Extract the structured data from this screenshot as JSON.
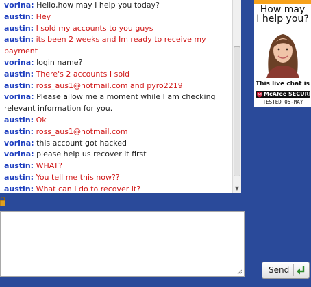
{
  "transcript": {
    "messages": [
      {
        "sender": "vorina:",
        "role": "agent",
        "text": "Hello,how may I help you today?"
      },
      {
        "sender": "austin:",
        "role": "user",
        "text": "Hey"
      },
      {
        "sender": "austin:",
        "role": "user",
        "text": "I sold my accounts to you guys"
      },
      {
        "sender": "austin:",
        "role": "user",
        "text": "its been 2 weeks and Im ready to receive my payment"
      },
      {
        "sender": "vorina:",
        "role": "agent",
        "text": "login name?"
      },
      {
        "sender": "austin:",
        "role": "user",
        "text": "There's 2 accounts I sold"
      },
      {
        "sender": "austin:",
        "role": "user",
        "text": "ross_aus1@hotmail.com and pyro2219"
      },
      {
        "sender": "vorina:",
        "role": "agent",
        "text": "Please allow me a moment while I am checking relevant information for you."
      },
      {
        "sender": "austin:",
        "role": "user",
        "text": "Ok"
      },
      {
        "sender": "austin:",
        "role": "user",
        "text": "ross_aus1@hotmail.com"
      },
      {
        "sender": "vorina:",
        "role": "agent",
        "text": "this account got hacked"
      },
      {
        "sender": "vorina:",
        "role": "agent",
        "text": "please help us recover it first"
      },
      {
        "sender": "austin:",
        "role": "user",
        "text": "WHAT?"
      },
      {
        "sender": "austin:",
        "role": "user",
        "text": "You tell me this now??"
      },
      {
        "sender": "austin:",
        "role": "user",
        "text": "What can I do to recover it?"
      }
    ]
  },
  "input": {
    "value": ""
  },
  "send_button": {
    "label": "Send",
    "icon": "enter-arrow-icon"
  },
  "promo": {
    "headline_line1": "How may",
    "headline_line2": "I help you?",
    "note": "This live chat is",
    "badge_label": "McAfee SECURE",
    "tested_label": "TESTED  05-MAY"
  },
  "colors": {
    "background": "#2a4a9a",
    "sender": "#1f3fbf",
    "user_text": "#d01818",
    "agent_text": "#222222"
  }
}
